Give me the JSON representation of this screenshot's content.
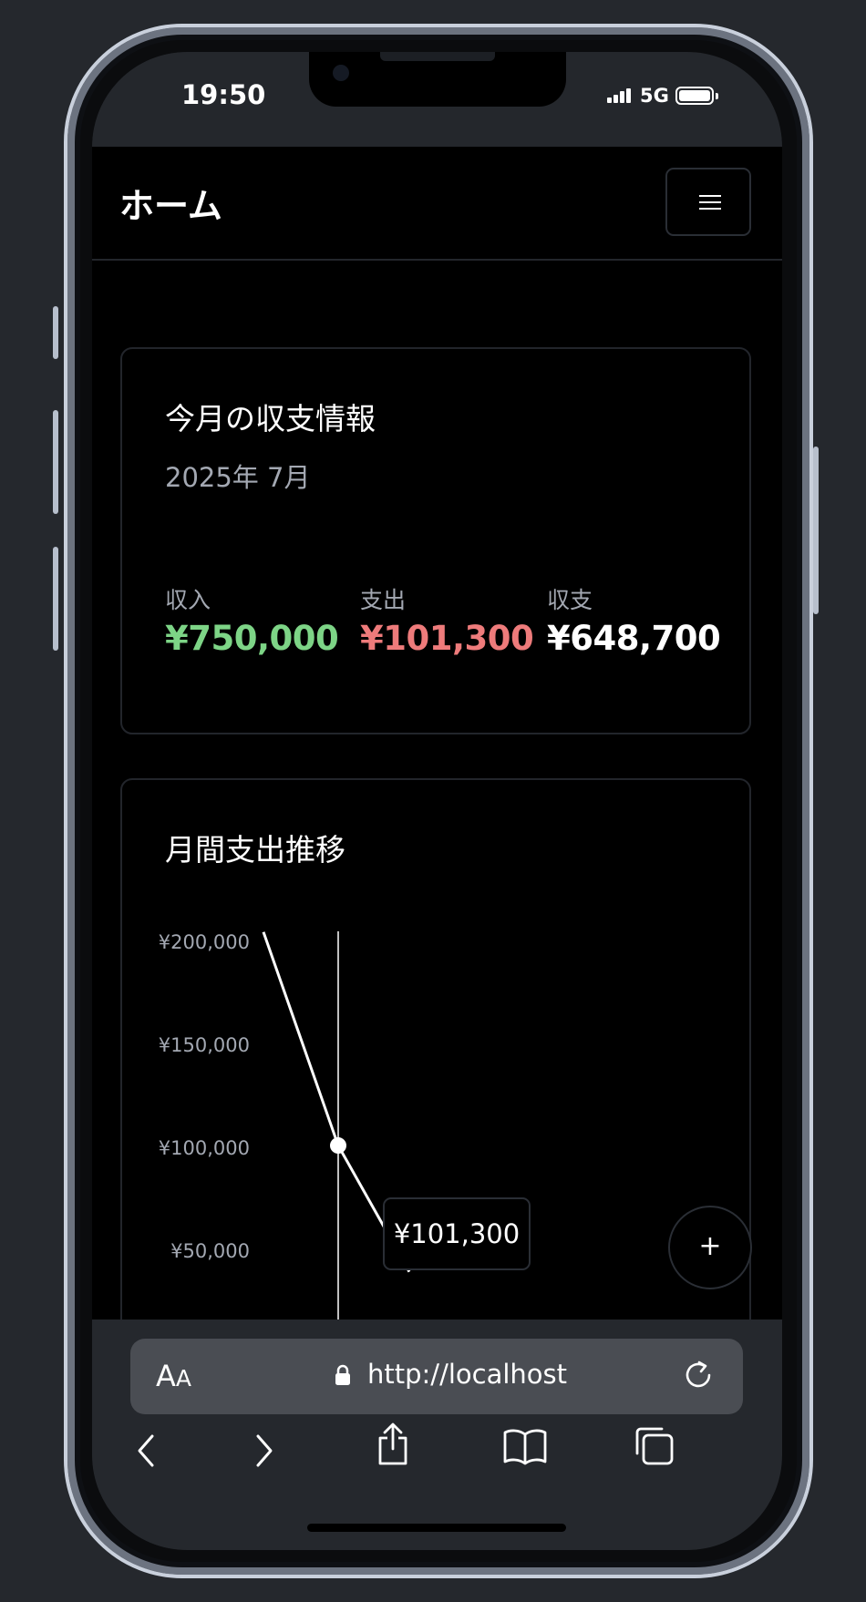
{
  "status_bar": {
    "time": "19:50",
    "network": "5G"
  },
  "header": {
    "title": "ホーム"
  },
  "summary": {
    "title": "今月の収支情報",
    "period": "2025年 7月",
    "income": {
      "label": "収入",
      "value": "¥750,000",
      "color": "#7dd486"
    },
    "expense": {
      "label": "支出",
      "value": "¥101,300",
      "color": "#ee7b7b"
    },
    "balance": {
      "label": "収支",
      "value": "¥648,700",
      "color": "#ffffff"
    }
  },
  "chart_card": {
    "title": "月間支出推移"
  },
  "chart_data": {
    "type": "line",
    "title": "",
    "yticks": [
      "¥200,000",
      "¥150,000",
      "¥100,000",
      "¥50,000"
    ],
    "ytick_values": [
      200000,
      150000,
      100000,
      50000
    ],
    "highlight": {
      "value": 101300,
      "label": "¥101,300"
    },
    "series": [
      {
        "values": [
          205000,
          101300,
          40000
        ]
      }
    ]
  },
  "fab": {
    "label": "+"
  },
  "browser": {
    "aa_big": "A",
    "aa_small": "A",
    "url": "http://localhost"
  }
}
